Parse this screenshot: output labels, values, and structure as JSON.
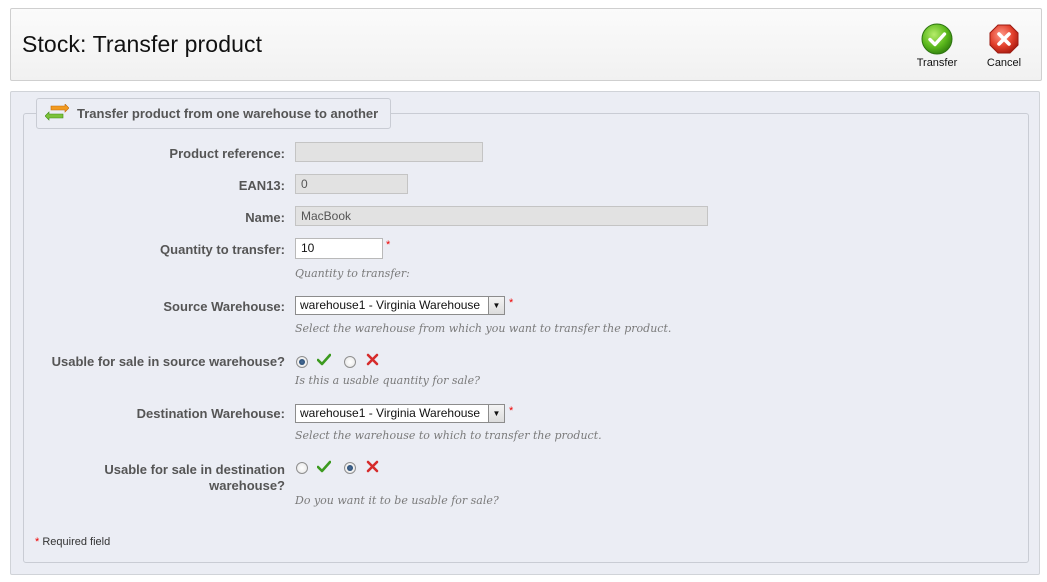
{
  "header": {
    "title": "Stock: Transfer product",
    "transfer_label": "Transfer",
    "cancel_label": "Cancel",
    "transfer_icon": "check-circle-icon",
    "cancel_icon": "x-circle-icon"
  },
  "form": {
    "legend": "Transfer product from one warehouse to another",
    "legend_icon": "transfer-arrows-icon",
    "required_star": "*",
    "product_reference": {
      "label": "Product reference:",
      "value": ""
    },
    "ean13": {
      "label": "EAN13:",
      "value": "0"
    },
    "name": {
      "label": "Name:",
      "value": "MacBook"
    },
    "quantity": {
      "label": "Quantity to transfer:",
      "value": "10",
      "help": "Quantity to transfer:"
    },
    "source_warehouse": {
      "label": "Source Warehouse:",
      "selected": "warehouse1 - Virginia Warehouse",
      "help": "Select the warehouse from which you want to transfer the product."
    },
    "usable_source": {
      "label": "Usable for sale in source warehouse?",
      "selected": "yes",
      "help": "Is this a usable quantity for sale?"
    },
    "destination_warehouse": {
      "label": "Destination Warehouse:",
      "selected": "warehouse1 - Virginia Warehouse",
      "help": "Select the warehouse to which to transfer the product."
    },
    "usable_destination": {
      "label_line1": "Usable for sale in destination",
      "label_line2": "warehouse?",
      "selected": "no",
      "help": "Do you want it to be usable for sale?"
    },
    "required_note": "Required field"
  },
  "colors": {
    "yes_green": "#3c9a1f",
    "no_red": "#d62b2b",
    "panel_bg": "#ebedf4"
  }
}
